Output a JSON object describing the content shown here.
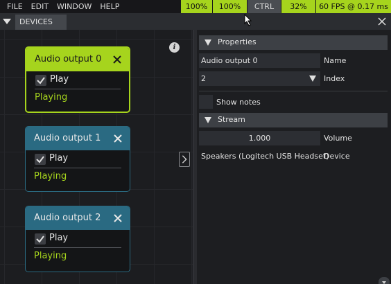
{
  "menu": {
    "items": [
      "FILE",
      "EDIT",
      "WINDOW",
      "HELP"
    ]
  },
  "status": {
    "zoom1": "100%",
    "zoom2": "100%",
    "modifier": "CTRL",
    "percent": "32%",
    "fps": "60 FPS @ 0.17 ms"
  },
  "tabbar": {
    "tab_label": "DEVICES"
  },
  "nodes": [
    {
      "title": "Audio output 0",
      "checkbox_label": "Play",
      "checked": true,
      "status": "Playing",
      "selected": true
    },
    {
      "title": "Audio output 1",
      "checkbox_label": "Play",
      "checked": true,
      "status": "Playing",
      "selected": false
    },
    {
      "title": "Audio output 2",
      "checkbox_label": "Play",
      "checked": true,
      "status": "Playing",
      "selected": false
    }
  ],
  "properties": {
    "section_title": "Properties",
    "name_value": "Audio output 0",
    "name_label": "Name",
    "index_value": "2",
    "index_label": "Index",
    "show_notes_label": "Show notes",
    "show_notes_checked": false
  },
  "stream": {
    "section_title": "Stream",
    "volume_value": "1.000",
    "volume_label": "Volume",
    "device_value": "Speakers (Logitech USB Headset)",
    "device_label": "Device"
  },
  "colors": {
    "accent": "#a6d41d",
    "node_header": "#2a6a82",
    "background": "#1a1a1e"
  },
  "icons": {
    "info": "info-icon",
    "close": "close-icon",
    "check": "checkmark-icon",
    "expand": "chevron-right-icon",
    "collapse": "triangle-down-icon",
    "dropdown": "triangle-down-icon"
  }
}
